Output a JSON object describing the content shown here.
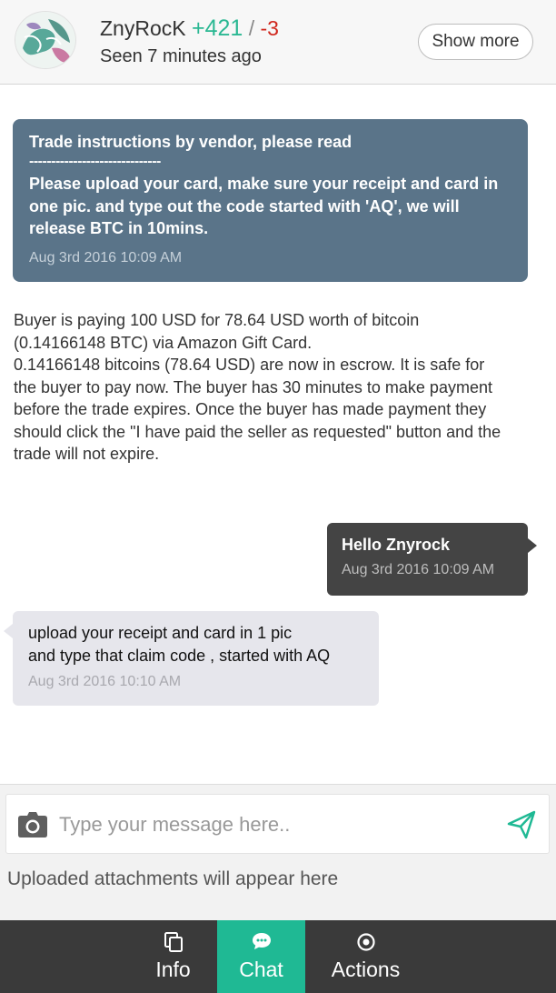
{
  "header": {
    "username": "ZnyRocK",
    "score_positive": "+421",
    "score_separator": "/",
    "score_negative": "-3",
    "seen": "Seen 7 minutes ago",
    "show_more_label": "Show more"
  },
  "instructions": {
    "title": "Trade instructions by vendor, please read",
    "divider": "------------------------------",
    "body": "Please upload your card, make sure your receipt and card in one pic. and type out the code started with 'AQ', we will release BTC in 10mins.",
    "timestamp": "Aug 3rd 2016 10:09 AM"
  },
  "system_message": {
    "line1": "Buyer is paying 100 USD for 78.64 USD worth of bitcoin (0.14166148 BTC) via Amazon Gift Card.",
    "line2": "0.14166148 bitcoins (78.64 USD) are now in escrow. It is safe for the buyer to pay now. The buyer has 30 minutes to make payment before the trade expires. Once the buyer has made payment they should click the \"I have paid the seller as requested\" button and the trade will not expire."
  },
  "messages": [
    {
      "direction": "outgoing",
      "text": "Hello Znyrock",
      "timestamp": "Aug 3rd 2016 10:09 AM"
    },
    {
      "direction": "incoming",
      "line1": "upload your receipt and card in 1 pic",
      "line2": "and type that claim code , started with AQ",
      "timestamp": "Aug 3rd 2016 10:10 AM"
    }
  ],
  "composer": {
    "placeholder": "Type your message here..",
    "attachments_note": "Uploaded attachments will appear here",
    "camera_icon": "camera-icon",
    "send_icon": "send-icon"
  },
  "nav": {
    "items": [
      {
        "label": "Info",
        "icon": "copy-icon",
        "active": false
      },
      {
        "label": "Chat",
        "icon": "chat-bubble-icon",
        "active": true
      },
      {
        "label": "Actions",
        "icon": "target-icon",
        "active": false
      }
    ]
  },
  "colors": {
    "accent": "#1fb994",
    "score_positive": "#2bb893",
    "score_negative": "#d0271d",
    "instructions_bg": "#5a7489",
    "outgoing_bubble": "#444444",
    "incoming_bubble": "#e6e6ec",
    "nav_bg": "#3a3a3a"
  }
}
